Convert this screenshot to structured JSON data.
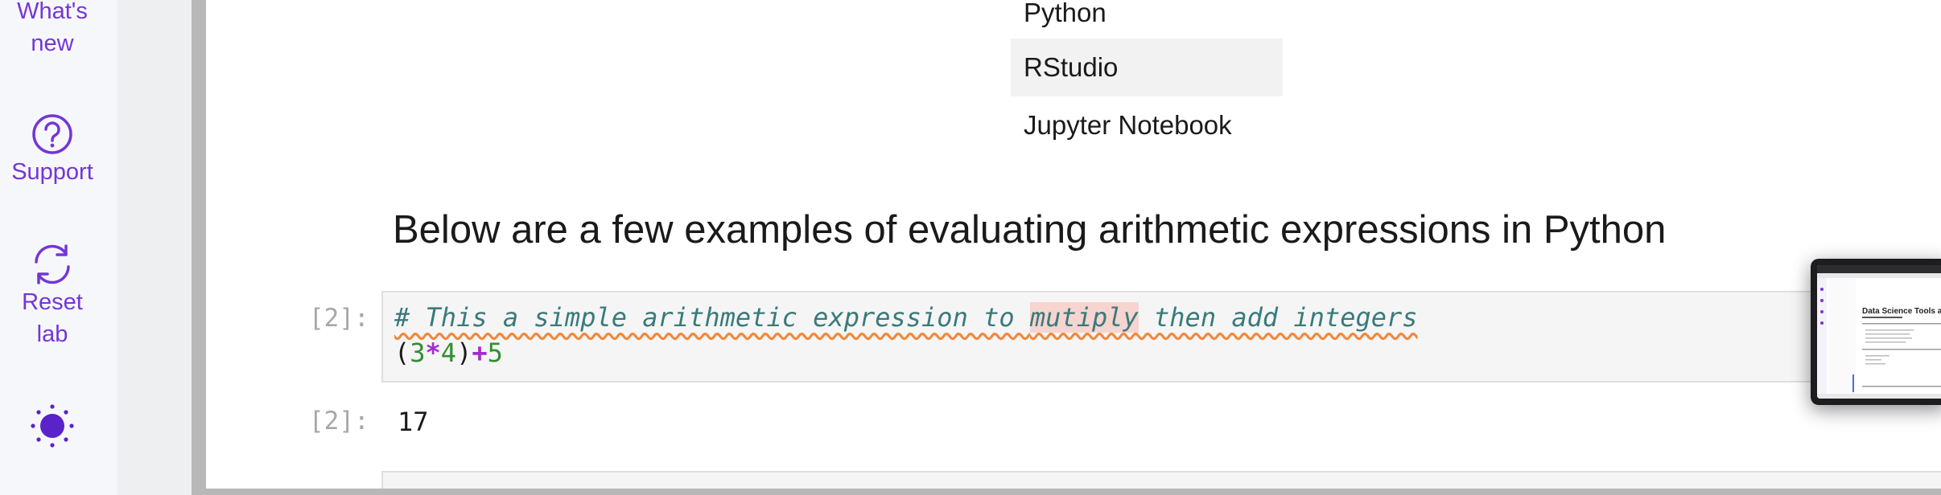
{
  "sidebar": {
    "whats_new": "What's new",
    "whats_new_line1": "What's",
    "whats_new_line2": "new",
    "support": "Support",
    "reset_line1": "Reset",
    "reset_line2": "lab",
    "accent_color": "#7436d6",
    "theme_icon": "sun-icon"
  },
  "table": {
    "rows": [
      "Python",
      "RStudio",
      "Jupyter Notebook"
    ]
  },
  "markdown": {
    "heading": "Below are a few examples of evaluating arithmetic expressions in Python"
  },
  "cells": [
    {
      "prompt": "[2]:",
      "comment_pre": "# This a simple arithmetic expression to ",
      "comment_misspelled": "mutiply",
      "comment_post": " then add integers",
      "code": {
        "open": "(",
        "a": "3",
        "mul": "*",
        "b": "4",
        "close": ")",
        "add": "+",
        "c": "5"
      }
    }
  ],
  "outputs": [
    {
      "prompt": "[2]:",
      "value": "17"
    }
  ],
  "thumbnail": {
    "title": "Data Science Tools and Ecosystem"
  }
}
